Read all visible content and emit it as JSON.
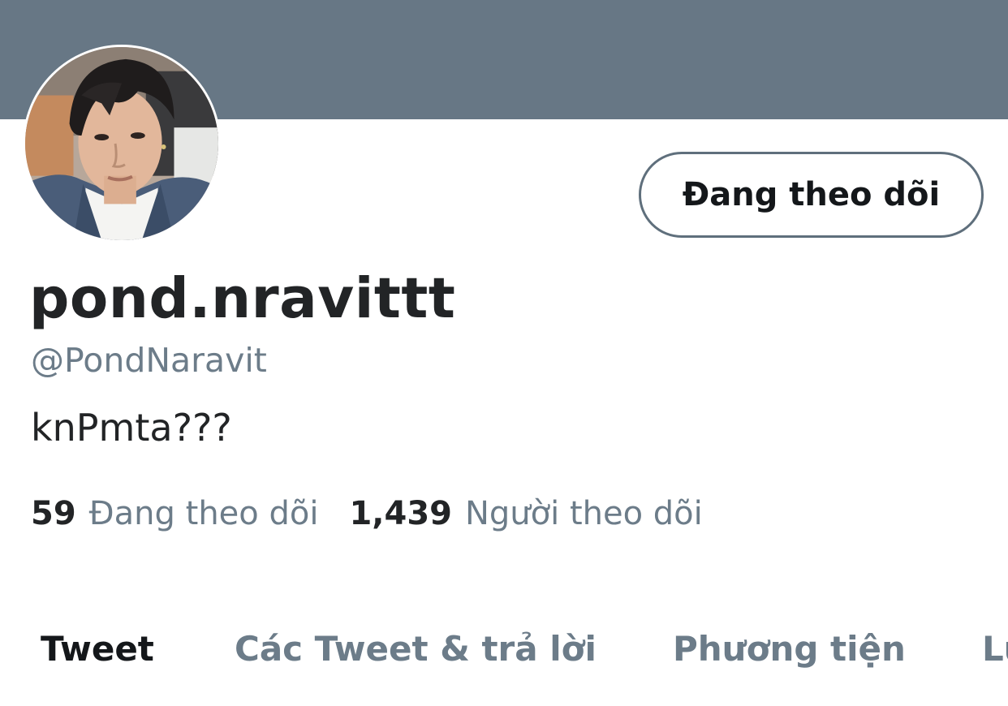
{
  "profile": {
    "display_name": "pond.nravittt",
    "handle": "@PondNaravit",
    "bio": "knPmta???",
    "banner_color": "#677785",
    "follow_button_label": "Đang theo dõi"
  },
  "stats": {
    "following_count": "59",
    "following_label": "Đang theo dõi",
    "followers_count": "1,439",
    "followers_label": "Người theo dõi"
  },
  "tabs": [
    {
      "label": "Tweet",
      "active": true
    },
    {
      "label": "Các Tweet & trả lời",
      "active": false
    },
    {
      "label": "Phương tiện",
      "active": false
    },
    {
      "label": "Lư",
      "active": false
    }
  ],
  "colors": {
    "text_primary": "#222426",
    "text_secondary": "#6c7c89",
    "button_border": "#5f6f7c",
    "background": "#ffffff"
  }
}
